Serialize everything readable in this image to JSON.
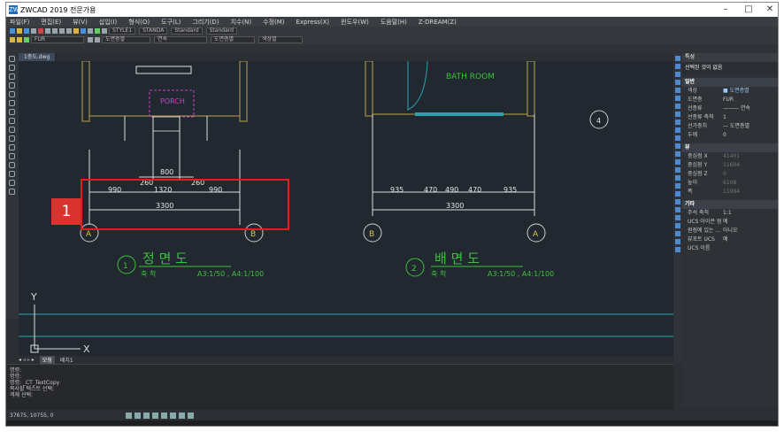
{
  "window": {
    "title": "ZWCAD 2019 전문가용",
    "app_icon": "ZW",
    "controls": [
      "–",
      "□",
      "✕"
    ]
  },
  "menu": [
    "파일(F)",
    "편집(E)",
    "뷰(V)",
    "삽입(I)",
    "형식(O)",
    "도구(L)",
    "그리기(D)",
    "치수(N)",
    "수정(M)",
    "Express(X)",
    "윈도우(W)",
    "도움말(H)",
    "Z-DREAM(Z)"
  ],
  "toolbar": {
    "textstyle": "STYLE1",
    "dimstyle": "STANDA",
    "tablestyle": "Standard",
    "multileader": "Standard",
    "layer": "FUR",
    "color": "도면층별",
    "linetype": "연속",
    "lineweight": "도면층별",
    "plotstyle": "색상별"
  },
  "doc_tab": "1층도.dwg",
  "drawing": {
    "left": {
      "room_label": "PORCH",
      "dims_top": "800",
      "dims_small": [
        "260",
        "260"
      ],
      "dims_row": [
        "990",
        "1320",
        "990"
      ],
      "dims_total": "3300",
      "axis_a": "A",
      "axis_b": "B",
      "circle_num": "1",
      "title": "정 면 도",
      "scale_label": "축 척",
      "scale_value": "A3:1/50 , A4:1/100"
    },
    "right": {
      "room_label": "BATH ROOM",
      "dims_row": [
        "935",
        "470",
        "490",
        "470",
        "935"
      ],
      "dims_total": "3300",
      "axis_b": "B",
      "axis_a": "A",
      "circle_num": "2",
      "title": "배 면 도",
      "scale_label": "축 척",
      "scale_value": "A3:1/50 , A4:1/100",
      "side_tag": "4"
    },
    "ucs_y": "Y",
    "ucs_x": "X",
    "stamp": "1"
  },
  "view_tabs": [
    "모형",
    "배치1"
  ],
  "command_lines": [
    "명령:",
    "명령:",
    "명령: _CT_TextCopy",
    "복사할 텍스트 선택:",
    "객체 선택:"
  ],
  "status_coords": "37675, 10755, 0",
  "properties": {
    "header": "특성",
    "selection": "선택된 것이 없음",
    "general_title": "일반",
    "general": [
      {
        "k": "색상",
        "v": "■ 도면층별"
      },
      {
        "k": "도면층",
        "v": "FUR"
      },
      {
        "k": "선종류",
        "v": "——— 연속"
      },
      {
        "k": "선종류 축척",
        "v": "1"
      },
      {
        "k": "선가중치",
        "v": "— 도면층별"
      },
      {
        "k": "두께",
        "v": "0"
      }
    ],
    "view_title": "뷰",
    "view": [
      {
        "k": "중심점 X",
        "v": "41401"
      },
      {
        "k": "중심점 Y",
        "v": "11604"
      },
      {
        "k": "중심점 Z",
        "v": "0"
      },
      {
        "k": "높이",
        "v": "6108"
      },
      {
        "k": "폭",
        "v": "11094"
      }
    ],
    "misc_title": "기타",
    "misc": [
      {
        "k": "주석 축척",
        "v": "1:1"
      },
      {
        "k": "UCS 아이콘 켬",
        "v": "예"
      },
      {
        "k": "원점에 있는 ...",
        "v": "아니오"
      },
      {
        "k": "뷰포트 UCS",
        "v": "예"
      },
      {
        "k": "UCS 이름",
        "v": ""
      }
    ]
  }
}
